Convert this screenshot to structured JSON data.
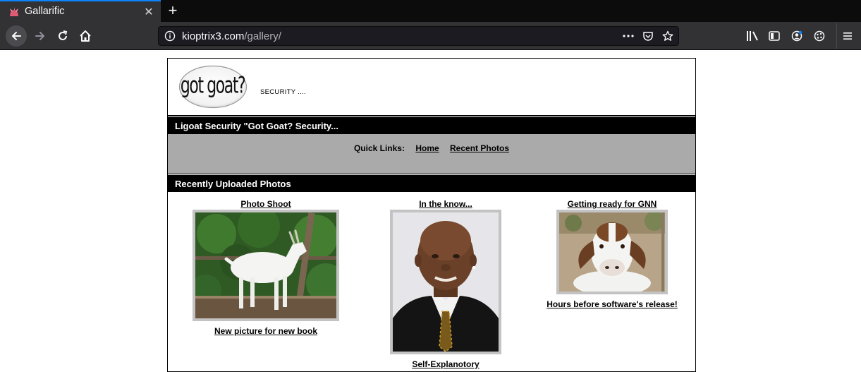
{
  "browser": {
    "tab": {
      "title": "Gallarific",
      "close_symbol": "✕"
    },
    "new_tab_symbol": "+",
    "url": {
      "host": "kioptrix3.com",
      "path": "/gallery/"
    },
    "icons": [
      "back-icon",
      "forward-icon",
      "reload-icon",
      "home-icon",
      "info-icon",
      "more-icon",
      "pocket-icon",
      "star-icon",
      "library-icon",
      "sidebar-icon",
      "account-icon",
      "extension-icon",
      "menu-icon"
    ]
  },
  "header": {
    "logo_text": "got goat?",
    "tagline": "SECURITY ...."
  },
  "site_bar": {
    "title": "Ligoat Security \"Got Goat? Security..."
  },
  "quick_links": {
    "label": "Quick Links:",
    "links": [
      "Home",
      "Recent Photos"
    ]
  },
  "recent_bar": {
    "title": "Recently Uploaded Photos"
  },
  "photos": [
    {
      "title": "Photo Shoot",
      "caption": "New picture for new book",
      "image": "white-goat-photo"
    },
    {
      "title": "In the know...",
      "caption": "Self-Explanotory",
      "image": "man-portrait-photo"
    },
    {
      "title": "Getting ready for GNN",
      "caption": "Hours before software's release!",
      "image": "goat-closeup-photo"
    }
  ],
  "colors": {
    "accent": "#0a84ff",
    "chrome_dark": "#0c0c0d",
    "chrome": "#323234",
    "quick_links_bg": "#aaaaaa"
  }
}
